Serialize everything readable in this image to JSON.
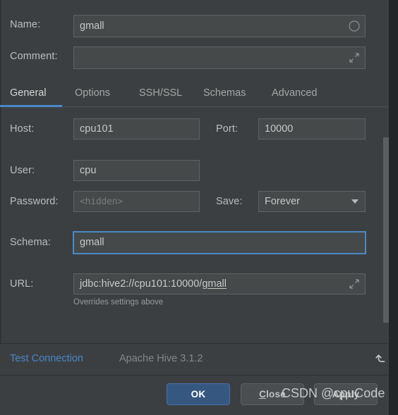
{
  "dialog": {
    "name_label": "Name:",
    "name_value": "gmall",
    "comment_label": "Comment:",
    "comment_value": "",
    "comment_placeholder": ""
  },
  "tabs": [
    {
      "label": "General",
      "active": true
    },
    {
      "label": "Options",
      "active": false
    },
    {
      "label": "SSH/SSL",
      "active": false
    },
    {
      "label": "Schemas",
      "active": false
    },
    {
      "label": "Advanced",
      "active": false
    }
  ],
  "form": {
    "host_label": "Host:",
    "host_value": "cpu101",
    "port_label": "Port:",
    "port_value": "10000",
    "user_label": "User:",
    "user_value": "cpu",
    "password_label": "Password:",
    "password_placeholder": "<hidden>",
    "save_label": "Save:",
    "save_value": "Forever",
    "schema_label": "Schema:",
    "schema_value": "gmall",
    "url_label": "URL:",
    "url_prefix": "jdbc:hive2://cpu101:10000/",
    "url_suffix": "gmall",
    "url_hint": "Overrides settings above"
  },
  "footer": {
    "test_connection": "Test Connection",
    "driver_status": "Apache Hive 3.1.2",
    "ok_label": "OK",
    "close_mnemonic": "C",
    "close_rest": "lose",
    "apply_label": "Apply"
  },
  "watermark": "CSDN @cpuCode",
  "colors": {
    "accent": "#4a88c7",
    "link": "#4b86c9",
    "default_button": "#365880",
    "panel": "#3c3f41",
    "field": "#45494a"
  }
}
